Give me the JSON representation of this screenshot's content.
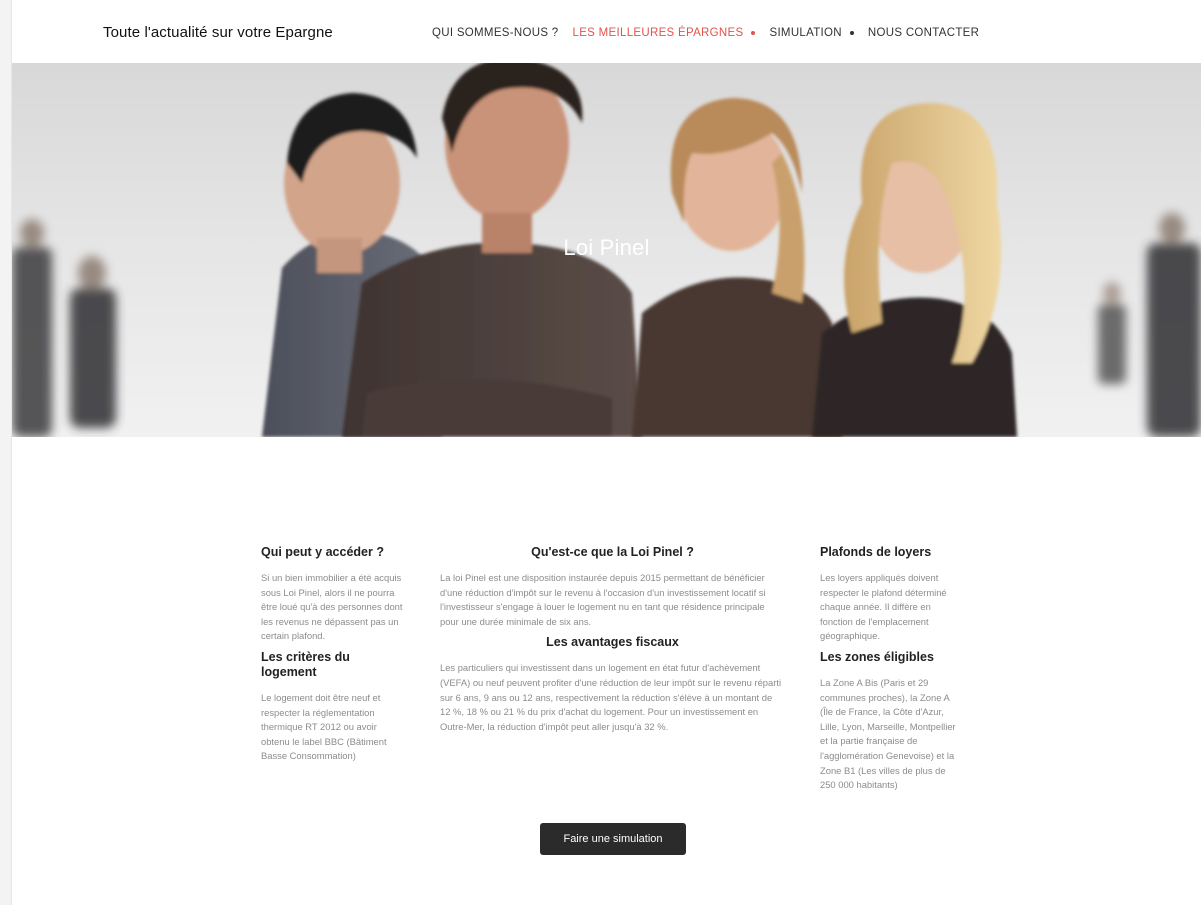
{
  "header": {
    "site_title": "Toute l'actualité sur votre Epargne",
    "nav": [
      {
        "label": "QUI SOMMES-NOUS ?",
        "has_dropdown": false,
        "active": false
      },
      {
        "label": "LES MEILLEURES ÉPARGNES",
        "has_dropdown": true,
        "active": true
      },
      {
        "label": "SIMULATION",
        "has_dropdown": true,
        "active": false
      },
      {
        "label": "NOUS CONTACTER",
        "has_dropdown": false,
        "active": false
      }
    ]
  },
  "hero": {
    "title": "Loi Pinel"
  },
  "left_column": {
    "section1_title": "Qui peut y accéder ?",
    "section1_text": "Si un bien immobilier a été acquis sous Loi Pinel, alors il ne pourra être loué qu'à des personnes dont les revenus ne dépassent pas un certain plafond.",
    "section2_title": "Les critères du logement",
    "section2_text": "Le logement doit être neuf et respecter la réglementation thermique RT 2012 ou avoir obtenu le label BBC (Bâtiment Basse Consommation)"
  },
  "middle_column": {
    "section1_title": "Qu'est-ce que la Loi Pinel ?",
    "section1_text": "La loi Pinel est une disposition instaurée depuis 2015 permettant de bénéficier d'une réduction d'impôt sur le revenu à l'occasion d'un investissement locatif si l'investisseur s'engage à louer le logement nu en tant que résidence principale pour une durée minimale de six ans.",
    "section2_title": "Les avantages fiscaux",
    "section2_text": "Les particuliers qui investissent dans un logement en état futur d'achèvement (VEFA) ou neuf peuvent profiter d'une réduction de leur impôt sur le revenu réparti sur 6 ans, 9 ans ou 12 ans, respectivement la réduction s'élève à un montant de 12 %, 18 % ou 21 % du prix d'achat du logement. Pour un investissement en Outre-Mer, la réduction d'impôt peut aller jusqu'à 32 %.",
    "button_label": "Faire une simulation"
  },
  "right_column": {
    "section1_title": "Plafonds de loyers",
    "section1_text": "Les loyers appliqués doivent respecter le plafond déterminé chaque année. Il diffère en fonction de l'emplacement géographique.",
    "section2_title": "Les zones éligibles",
    "section2_text": "La Zone A Bis (Paris et 29 communes proches), la Zone A (Île de France, la Côte d'Azur, Lille, Lyon, Marseille, Montpellier et la partie française de l'agglomération Genevoise) et la Zone B1 (Les villes de plus de 250 000 habitants)"
  },
  "colors": {
    "accent": "#e0544a",
    "button_bg": "#2b2b2b",
    "body_text": "#8c8c8c",
    "heading_text": "#222222"
  }
}
